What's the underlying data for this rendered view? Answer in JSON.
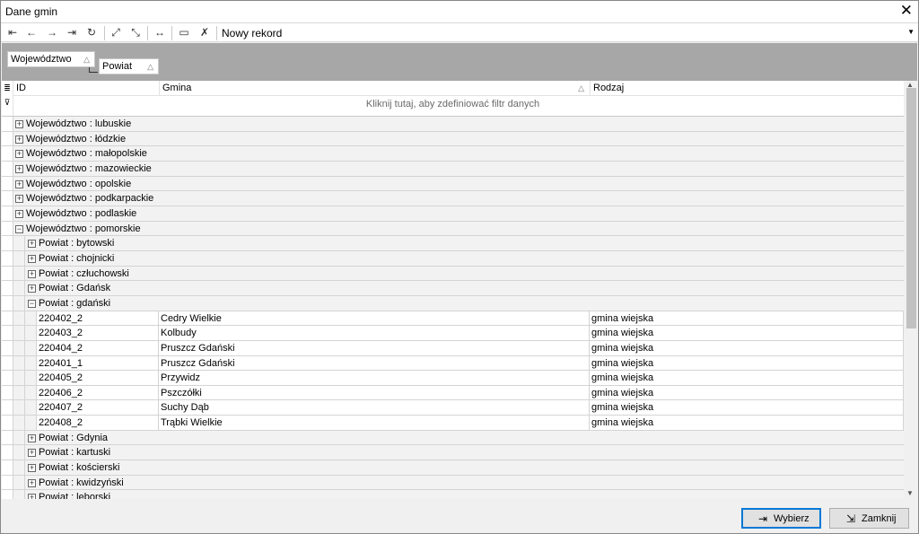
{
  "window": {
    "title": "Dane gmin",
    "close_icon": "close-icon"
  },
  "toolbar": {
    "icons": [
      "first-icon",
      "prev-icon",
      "next-icon",
      "last-icon",
      "refresh-icon",
      "expand-all-icon",
      "collapse-all-icon",
      "fit-columns-icon",
      "print-icon",
      "clear-filter-icon"
    ],
    "new_record": "Nowy rekord"
  },
  "group_panel": {
    "group1": "Województwo",
    "group2": "Powiat"
  },
  "grid": {
    "columns": {
      "id": "ID",
      "gmina": "Gmina",
      "rodzaj": "Rodzaj"
    },
    "filter_hint": "Kliknij tutaj, aby zdefiniować filtr danych",
    "rows": [
      {
        "type": "g1",
        "state": "+",
        "label": "Województwo : lubuskie"
      },
      {
        "type": "g1",
        "state": "+",
        "label": "Województwo : łódzkie"
      },
      {
        "type": "g1",
        "state": "+",
        "label": "Województwo : małopolskie"
      },
      {
        "type": "g1",
        "state": "+",
        "label": "Województwo : mazowieckie"
      },
      {
        "type": "g1",
        "state": "+",
        "label": "Województwo : opolskie"
      },
      {
        "type": "g1",
        "state": "+",
        "label": "Województwo : podkarpackie"
      },
      {
        "type": "g1",
        "state": "+",
        "label": "Województwo : podlaskie"
      },
      {
        "type": "g1",
        "state": "−",
        "label": "Województwo : pomorskie"
      },
      {
        "type": "g2",
        "state": "+",
        "label": "Powiat : bytowski"
      },
      {
        "type": "g2",
        "state": "+",
        "label": "Powiat : chojnicki"
      },
      {
        "type": "g2",
        "state": "+",
        "label": "Powiat : człuchowski"
      },
      {
        "type": "g2",
        "state": "+",
        "label": "Powiat : Gdańsk"
      },
      {
        "type": "g2",
        "state": "−",
        "label": "Powiat : gdański"
      },
      {
        "type": "d",
        "id": "220402_2",
        "gmina": "Cedry Wielkie",
        "rodzaj": "gmina wiejska"
      },
      {
        "type": "d",
        "id": "220403_2",
        "gmina": "Kolbudy",
        "rodzaj": "gmina wiejska"
      },
      {
        "type": "d",
        "id": "220404_2",
        "gmina": "Pruszcz Gdański",
        "rodzaj": "gmina wiejska"
      },
      {
        "type": "d",
        "id": "220401_1",
        "gmina": "Pruszcz Gdański",
        "rodzaj": "gmina wiejska"
      },
      {
        "type": "d",
        "id": "220405_2",
        "gmina": "Przywidz",
        "rodzaj": "gmina wiejska"
      },
      {
        "type": "d",
        "id": "220406_2",
        "gmina": "Pszczółki",
        "rodzaj": "gmina wiejska"
      },
      {
        "type": "d",
        "id": "220407_2",
        "gmina": "Suchy Dąb",
        "rodzaj": "gmina wiejska"
      },
      {
        "type": "d",
        "id": "220408_2",
        "gmina": "Trąbki Wielkie",
        "rodzaj": "gmina wiejska"
      },
      {
        "type": "g2",
        "state": "+",
        "label": "Powiat : Gdynia"
      },
      {
        "type": "g2",
        "state": "+",
        "label": "Powiat : kartuski"
      },
      {
        "type": "g2",
        "state": "+",
        "label": "Powiat : kościerski"
      },
      {
        "type": "g2",
        "state": "+",
        "label": "Powiat : kwidzyński"
      },
      {
        "type": "g2",
        "state": "+",
        "label": "Powiat : lęborski"
      }
    ]
  },
  "buttons": {
    "select": "Wybierz",
    "close": "Zamknij"
  }
}
